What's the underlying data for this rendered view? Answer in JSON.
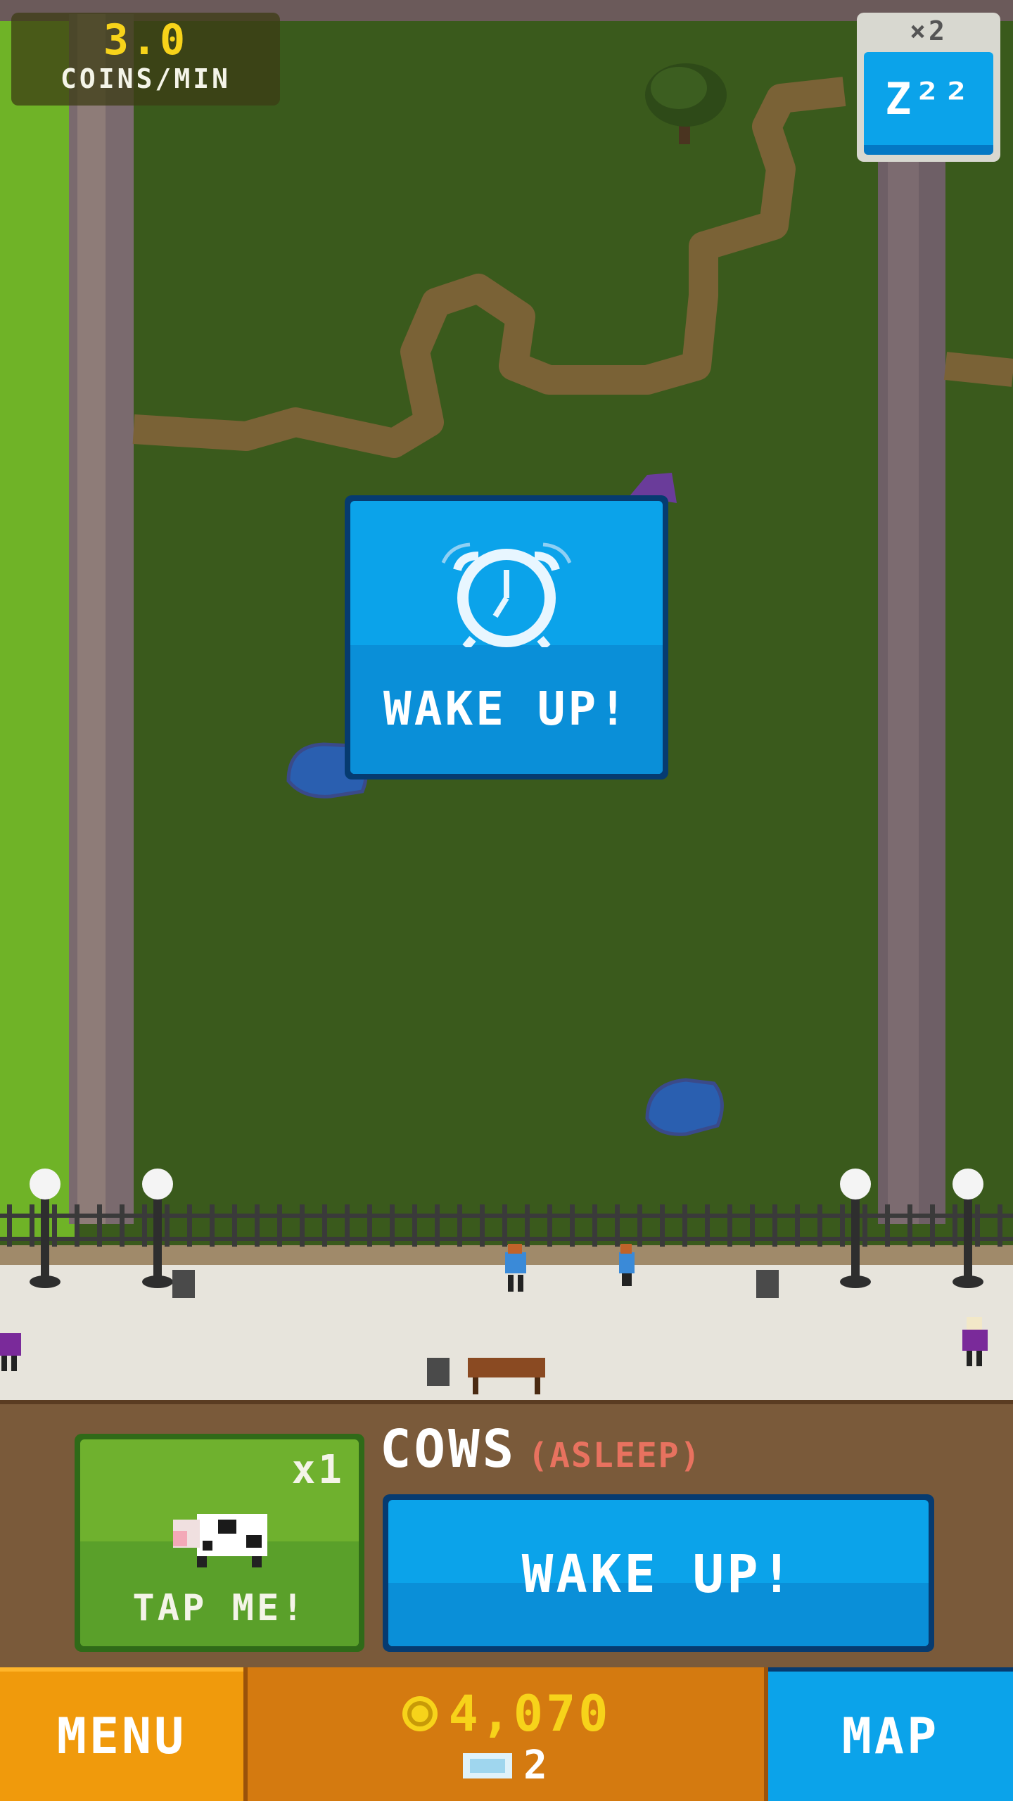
{
  "hud": {
    "rate_value": "3.0",
    "rate_unit": "COINS/MIN",
    "multiplier": "×2",
    "sleep_icon": "zzz-icon",
    "sleep_label": "Z²²"
  },
  "popup": {
    "icon": "alarm-clock-icon",
    "label": "WAKE UP!"
  },
  "animal_card": {
    "count": "x1",
    "icon": "cow-icon",
    "tap_label": "TAP ME!"
  },
  "animal": {
    "name": "COWS",
    "status": "(ASLEEP)"
  },
  "wake_button": {
    "label": "WAKE UP!"
  },
  "bottom": {
    "menu_label": "MENU",
    "coins": "4,070",
    "coin_icon": "coin-icon",
    "tickets": "2",
    "ticket_icon": "ticket-icon",
    "map_label": "MAP"
  },
  "colors": {
    "grass_dark": "#3a5a1c",
    "grass_light": "#6fb327",
    "wall": "#7a6a6e",
    "path": "#7a6236",
    "accent_blue": "#0ba3ea",
    "accent_green": "#5aa02a",
    "accent_orange": "#e0890b",
    "coin_yellow": "#f7d31a",
    "status_red": "#e8725f"
  }
}
